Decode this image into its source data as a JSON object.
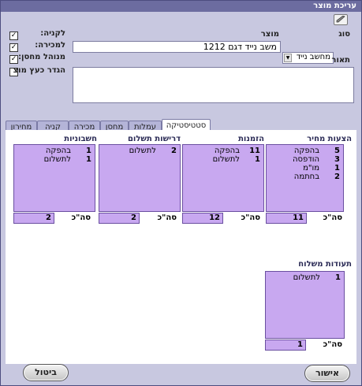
{
  "window": {
    "title": "עריכת מוצר"
  },
  "form": {
    "type_label": "סוג",
    "type_value": "מחשב נייד",
    "product_label": "מוצר",
    "product_value": "משב נייד דגם 1212",
    "description_label": "תאור",
    "checkboxes": [
      {
        "label": "לקניה:",
        "checked": true
      },
      {
        "label": "למכירה:",
        "checked": true
      },
      {
        "label": "מנוהל מחסן:",
        "checked": true
      },
      {
        "label": "הגדר כעץ מוצ",
        "checked": false
      }
    ]
  },
  "tabs": [
    "סטטיסטיקה",
    "עמלות",
    "מחסן",
    "מכירה",
    "קניה",
    "מחירון"
  ],
  "total_label": "סה\"כ",
  "groups": [
    {
      "title": "הצעות מחיר",
      "rows": [
        {
          "n": "5",
          "t": "בהפקה"
        },
        {
          "n": "3",
          "t": "הודפסה"
        },
        {
          "n": "1",
          "t": "מו\"מ"
        },
        {
          "n": "2",
          "t": "בחתמה"
        }
      ],
      "total": "11"
    },
    {
      "title": "הזמנות",
      "rows": [
        {
          "n": "11",
          "t": "בהפקה"
        },
        {
          "n": "1",
          "t": "לתשלום"
        }
      ],
      "total": "12"
    },
    {
      "title": "דרישות תשלום",
      "rows": [
        {
          "n": "2",
          "t": "לתשלום"
        }
      ],
      "total": "2"
    },
    {
      "title": "חשבוניות",
      "rows": [
        {
          "n": "1",
          "t": "בהפקה"
        },
        {
          "n": "1",
          "t": "לתשלום"
        }
      ],
      "total": "2"
    },
    {
      "title": "תעודות משלוח",
      "rows": [
        {
          "n": "1",
          "t": "לתשלום"
        }
      ],
      "total": "1"
    }
  ],
  "buttons": {
    "ok": "אישור",
    "cancel": "ביטול"
  }
}
